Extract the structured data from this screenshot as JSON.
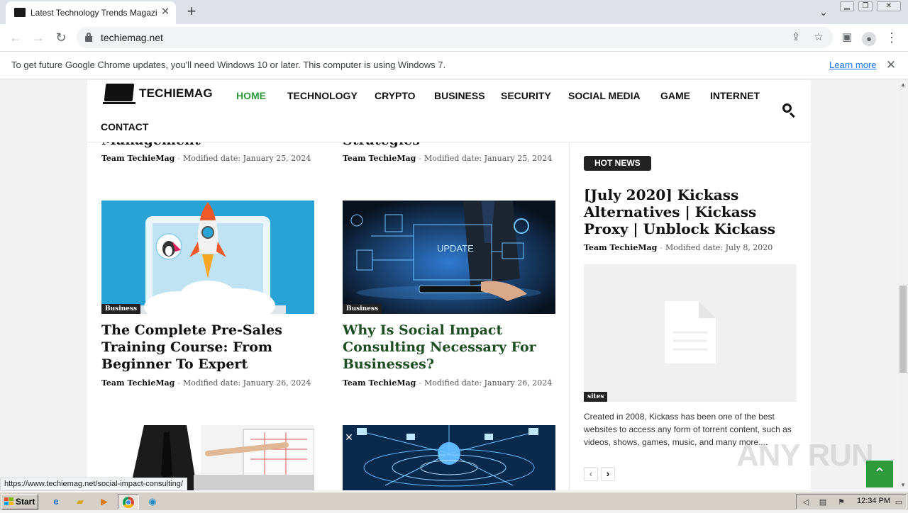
{
  "browser": {
    "tab_title": "Latest Technology Trends Magazine -",
    "url": "techiemag.net",
    "status_url": "https://www.techiemag.net/social-impact-consulting/"
  },
  "infobar": {
    "message": "To get future Google Chrome updates, you'll need Windows 10 or later. This computer is using Windows 7.",
    "link": "Learn more"
  },
  "site": {
    "logo_text": "TECHIEMAG",
    "nav": [
      "HOME",
      "TECHNOLOGY",
      "CRYPTO",
      "BUSINESS",
      "SECURITY",
      "SOCIAL MEDIA",
      "GAME",
      "INTERNET",
      "CONTACT"
    ],
    "active_nav": "HOME"
  },
  "top_posts": [
    {
      "title_fragment": "Management",
      "author": "Team TechieMag",
      "date": "Modified date: January 25, 2024"
    },
    {
      "title_fragment": "Strategies",
      "author": "Team TechieMag",
      "date": "Modified date: January 25, 2024"
    }
  ],
  "posts": [
    {
      "category": "Business",
      "title": "The Complete Pre-Sales Training Course: From Beginner To Expert",
      "author": "Team TechieMag",
      "date": "Modified date: January 26, 2024"
    },
    {
      "category": "Business",
      "title": "Why Is Social Impact Consulting Necessary For Businesses?",
      "author": "Team TechieMag",
      "date": "Modified date: January 26, 2024",
      "thumb_text": "UPDATE"
    }
  ],
  "sidebar": {
    "badge": "HOT NEWS",
    "title": "[July 2020] Kickass Alternatives | Kickass Proxy | Unblock Kickass",
    "author": "Team TechieMag",
    "date": "Modified date: July 8, 2020",
    "category": "sites",
    "excerpt": "Created in 2008, Kickass has been one of the best websites to access any form of torrent content, such as videos, shows, games, music, and many more...."
  },
  "meta_separator": "-",
  "watermark": "ANY RUN",
  "taskbar": {
    "start_label": "Start",
    "clock": "12:34 PM"
  },
  "colors": {
    "accent_green": "#2f9a3a",
    "nav_active": "#2f9a3a",
    "link_blue": "#1a73e8"
  }
}
